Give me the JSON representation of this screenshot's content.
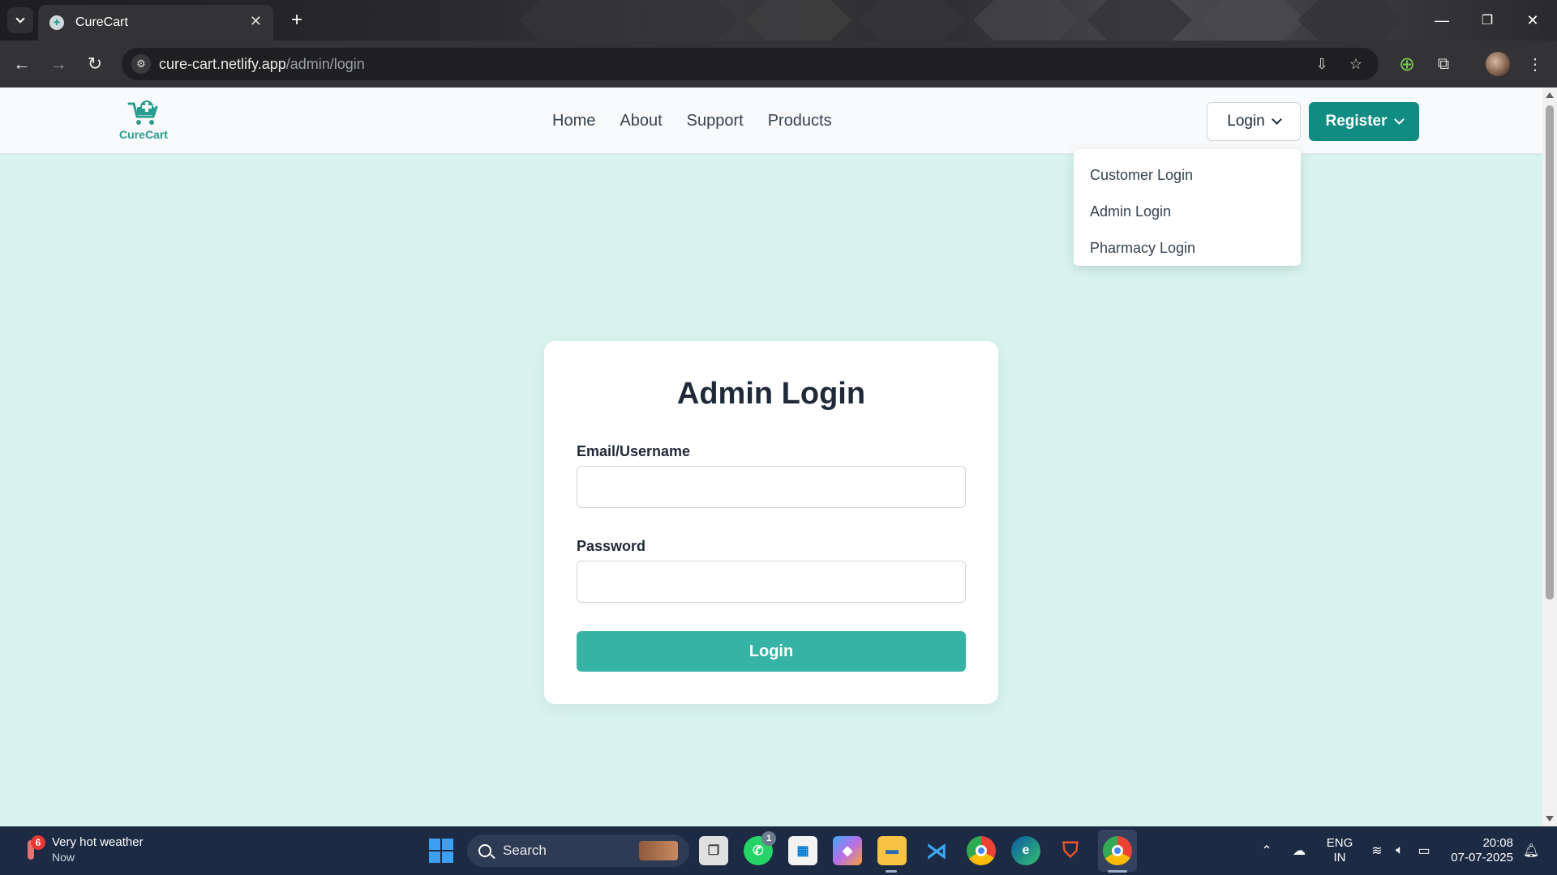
{
  "browser": {
    "tab_title": "CureCart",
    "url_domain": "cure-cart.netlify.app",
    "url_path": "/admin/login"
  },
  "site": {
    "logo_text": "CureCart",
    "nav": [
      "Home",
      "About",
      "Support",
      "Products"
    ],
    "login_btn": "Login",
    "register_btn": "Register",
    "login_menu": [
      "Customer Login",
      "Admin Login",
      "Pharmacy Login"
    ]
  },
  "form": {
    "title": "Admin Login",
    "email_label": "Email/Username",
    "email_value": "",
    "password_label": "Password",
    "password_value": "",
    "submit_label": "Login"
  },
  "taskbar": {
    "weather_badge": "6",
    "weather_title": "Very hot weather",
    "weather_sub": "Now",
    "search_label": "Search",
    "whatsapp_count": "1",
    "lang_top": "ENG",
    "lang_bottom": "IN",
    "time": "20:08",
    "date": "07-07-2025"
  },
  "colors": {
    "brand_teal": "#118c83",
    "button_teal": "#36b3a4",
    "page_bg": "#d8f3ee"
  }
}
